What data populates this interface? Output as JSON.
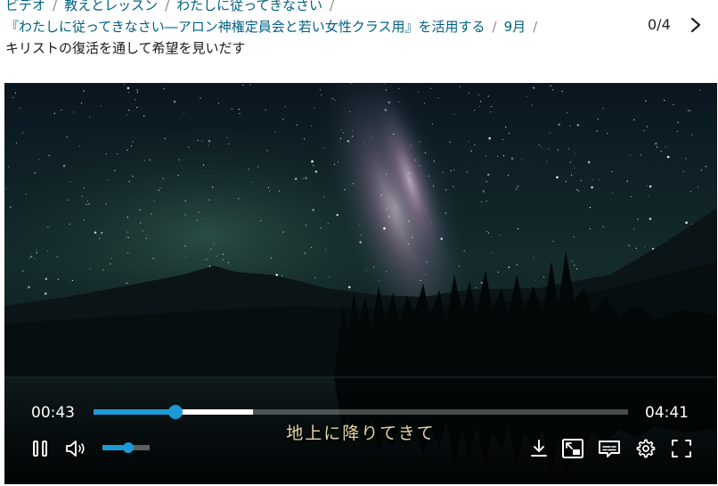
{
  "breadcrumb": {
    "items": [
      {
        "label": "ビデオ",
        "link": true
      },
      {
        "label": "教えとレッスン",
        "link": true
      },
      {
        "label": "わたしに従ってきなさい",
        "link": true
      },
      {
        "label": "『わたしに従ってきなさい―アロン神権定員会と若い女性クラス用』を活用する",
        "link": true
      },
      {
        "label": "9月",
        "link": true
      }
    ],
    "separator": "/",
    "current": "キリストの復活を通して希望を見いだす"
  },
  "pager": {
    "counter": "0/4"
  },
  "player": {
    "current_time": "00:43",
    "duration": "04:41",
    "played_fraction": 0.153,
    "buffered_fraction": 0.298,
    "volume_fraction": 0.55,
    "subtitle": "地上に降りてきて",
    "accent_color": "#1b9ad6",
    "icons": {
      "pause": "pause-icon",
      "volume": "volume-icon",
      "download": "download-icon",
      "pip": "picture-in-picture-icon",
      "captions": "captions-icon",
      "settings": "gear-icon",
      "fullscreen": "fullscreen-icon",
      "next": "chevron-right-icon"
    }
  }
}
